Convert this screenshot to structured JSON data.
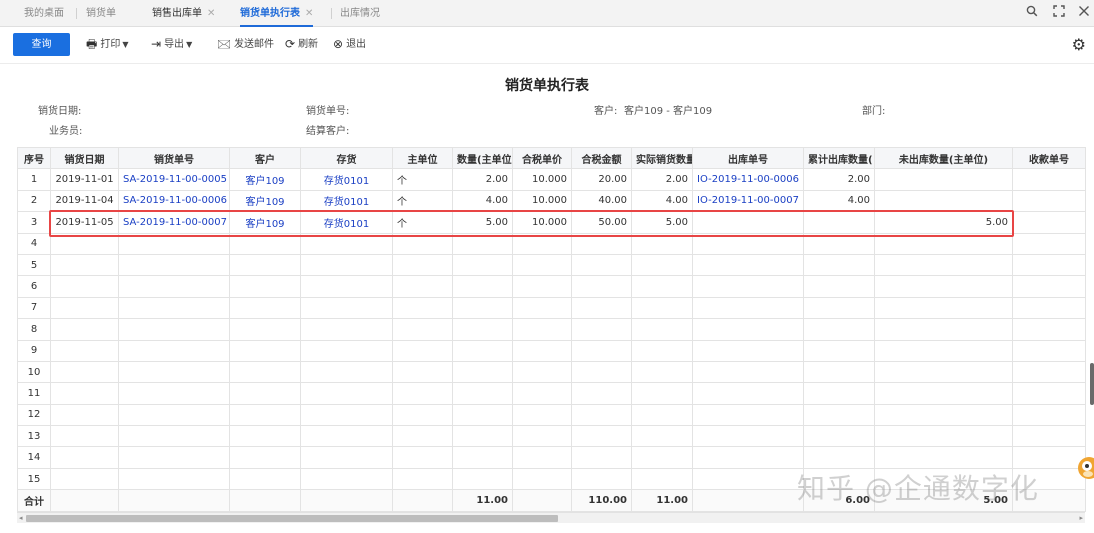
{
  "tabs": [
    {
      "label": "我的桌面",
      "closable": false,
      "active": false
    },
    {
      "label": "销货单",
      "closable": false,
      "active": false
    },
    {
      "label": "销售出库单",
      "closable": true,
      "active": false
    },
    {
      "label": "销货单执行表",
      "closable": true,
      "active": true
    },
    {
      "label": "出库情况",
      "closable": false,
      "active": false
    }
  ],
  "window_controls": [
    "search-icon",
    "maximize-icon",
    "close-icon"
  ],
  "toolbar": {
    "query": "查询",
    "print": "打印",
    "export": "导出",
    "send_mail": "发送邮件",
    "refresh": "刷新",
    "exit": "退出"
  },
  "report": {
    "title": "销货单执行表",
    "filters": {
      "sale_date_label": "销货日期:",
      "sale_no_label": "销货单号:",
      "customer_label": "客户:",
      "customer_value": "客户109 - 客户109",
      "dept_label": "部门:",
      "salesman_label": "业务员:",
      "settle_customer_label": "结算客户:"
    }
  },
  "table": {
    "columns": [
      "序号",
      "销货日期",
      "销货单号",
      "客户",
      "存货",
      "主单位",
      "数量(主单位",
      "合税单价",
      "合税金额",
      "实际销货数量",
      "出库单号",
      "累计出库数量(",
      "未出库数量(主单位)",
      "收款单号"
    ],
    "rows": [
      [
        "1",
        "2019-11-01",
        "SA-2019-11-00-0005",
        "客户109",
        "存货0101",
        "个",
        "2.00",
        "10.000",
        "20.00",
        "2.00",
        "IO-2019-11-00-0006",
        "2.00",
        "",
        ""
      ],
      [
        "2",
        "2019-11-04",
        "SA-2019-11-00-0006",
        "客户109",
        "存货0101",
        "个",
        "4.00",
        "10.000",
        "40.00",
        "4.00",
        "IO-2019-11-00-0007",
        "4.00",
        "",
        ""
      ],
      [
        "3",
        "2019-11-05",
        "SA-2019-11-00-0007",
        "客户109",
        "存货0101",
        "个",
        "5.00",
        "10.000",
        "50.00",
        "5.00",
        "",
        "",
        "5.00",
        ""
      ],
      [
        "4",
        "",
        "",
        "",
        "",
        "",
        "",
        "",
        "",
        "",
        "",
        "",
        "",
        ""
      ],
      [
        "5",
        "",
        "",
        "",
        "",
        "",
        "",
        "",
        "",
        "",
        "",
        "",
        "",
        ""
      ],
      [
        "6",
        "",
        "",
        "",
        "",
        "",
        "",
        "",
        "",
        "",
        "",
        "",
        "",
        ""
      ],
      [
        "7",
        "",
        "",
        "",
        "",
        "",
        "",
        "",
        "",
        "",
        "",
        "",
        "",
        ""
      ],
      [
        "8",
        "",
        "",
        "",
        "",
        "",
        "",
        "",
        "",
        "",
        "",
        "",
        "",
        ""
      ],
      [
        "9",
        "",
        "",
        "",
        "",
        "",
        "",
        "",
        "",
        "",
        "",
        "",
        "",
        ""
      ],
      [
        "10",
        "",
        "",
        "",
        "",
        "",
        "",
        "",
        "",
        "",
        "",
        "",
        "",
        ""
      ],
      [
        "11",
        "",
        "",
        "",
        "",
        "",
        "",
        "",
        "",
        "",
        "",
        "",
        "",
        ""
      ],
      [
        "12",
        "",
        "",
        "",
        "",
        "",
        "",
        "",
        "",
        "",
        "",
        "",
        "",
        ""
      ],
      [
        "13",
        "",
        "",
        "",
        "",
        "",
        "",
        "",
        "",
        "",
        "",
        "",
        "",
        ""
      ],
      [
        "14",
        "",
        "",
        "",
        "",
        "",
        "",
        "",
        "",
        "",
        "",
        "",
        "",
        ""
      ],
      [
        "15",
        "",
        "",
        "",
        "",
        "",
        "",
        "",
        "",
        "",
        "",
        "",
        "",
        ""
      ]
    ],
    "total": [
      "合计",
      "",
      "",
      "",
      "",
      "",
      "11.00",
      "",
      "110.00",
      "11.00",
      "",
      "6.00",
      "5.00",
      ""
    ]
  },
  "watermark": "知乎 @企通数字化",
  "colors": {
    "accent": "#1a6fe0",
    "highlight": "#e84545",
    "link": "#1a3fc4"
  }
}
